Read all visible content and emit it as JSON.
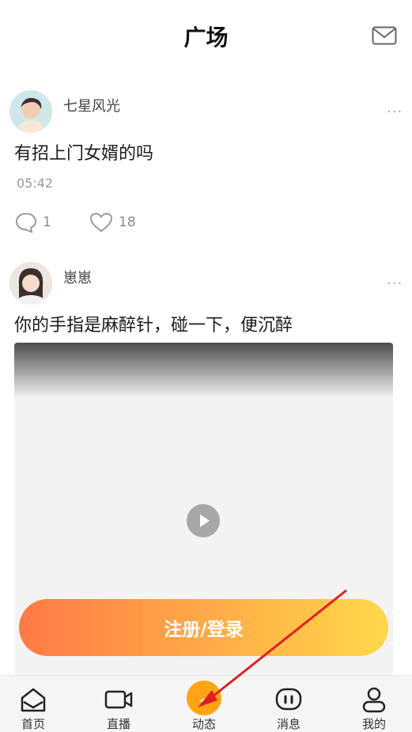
{
  "header": {
    "title": "广场"
  },
  "posts": [
    {
      "author": "七星风光",
      "text": "有招上门女婿的吗",
      "time": "05:42",
      "comments": "1",
      "likes": "18"
    },
    {
      "author": "崽崽",
      "text": "你的手指是麻醉针，碰一下，便沉醉"
    }
  ],
  "cta": {
    "label": "注册/登录"
  },
  "tabs": [
    {
      "label": "首页",
      "icon": "home-icon"
    },
    {
      "label": "直播",
      "icon": "video-camera-icon"
    },
    {
      "label": "动态",
      "icon": "send-icon"
    },
    {
      "label": "消息",
      "icon": "chat-icon"
    },
    {
      "label": "我的",
      "icon": "user-icon"
    }
  ],
  "colors": {
    "accent": "#ffa514",
    "cta_start": "#ff7a45",
    "cta_end": "#ffd84a",
    "annotation_arrow": "#e02020"
  }
}
